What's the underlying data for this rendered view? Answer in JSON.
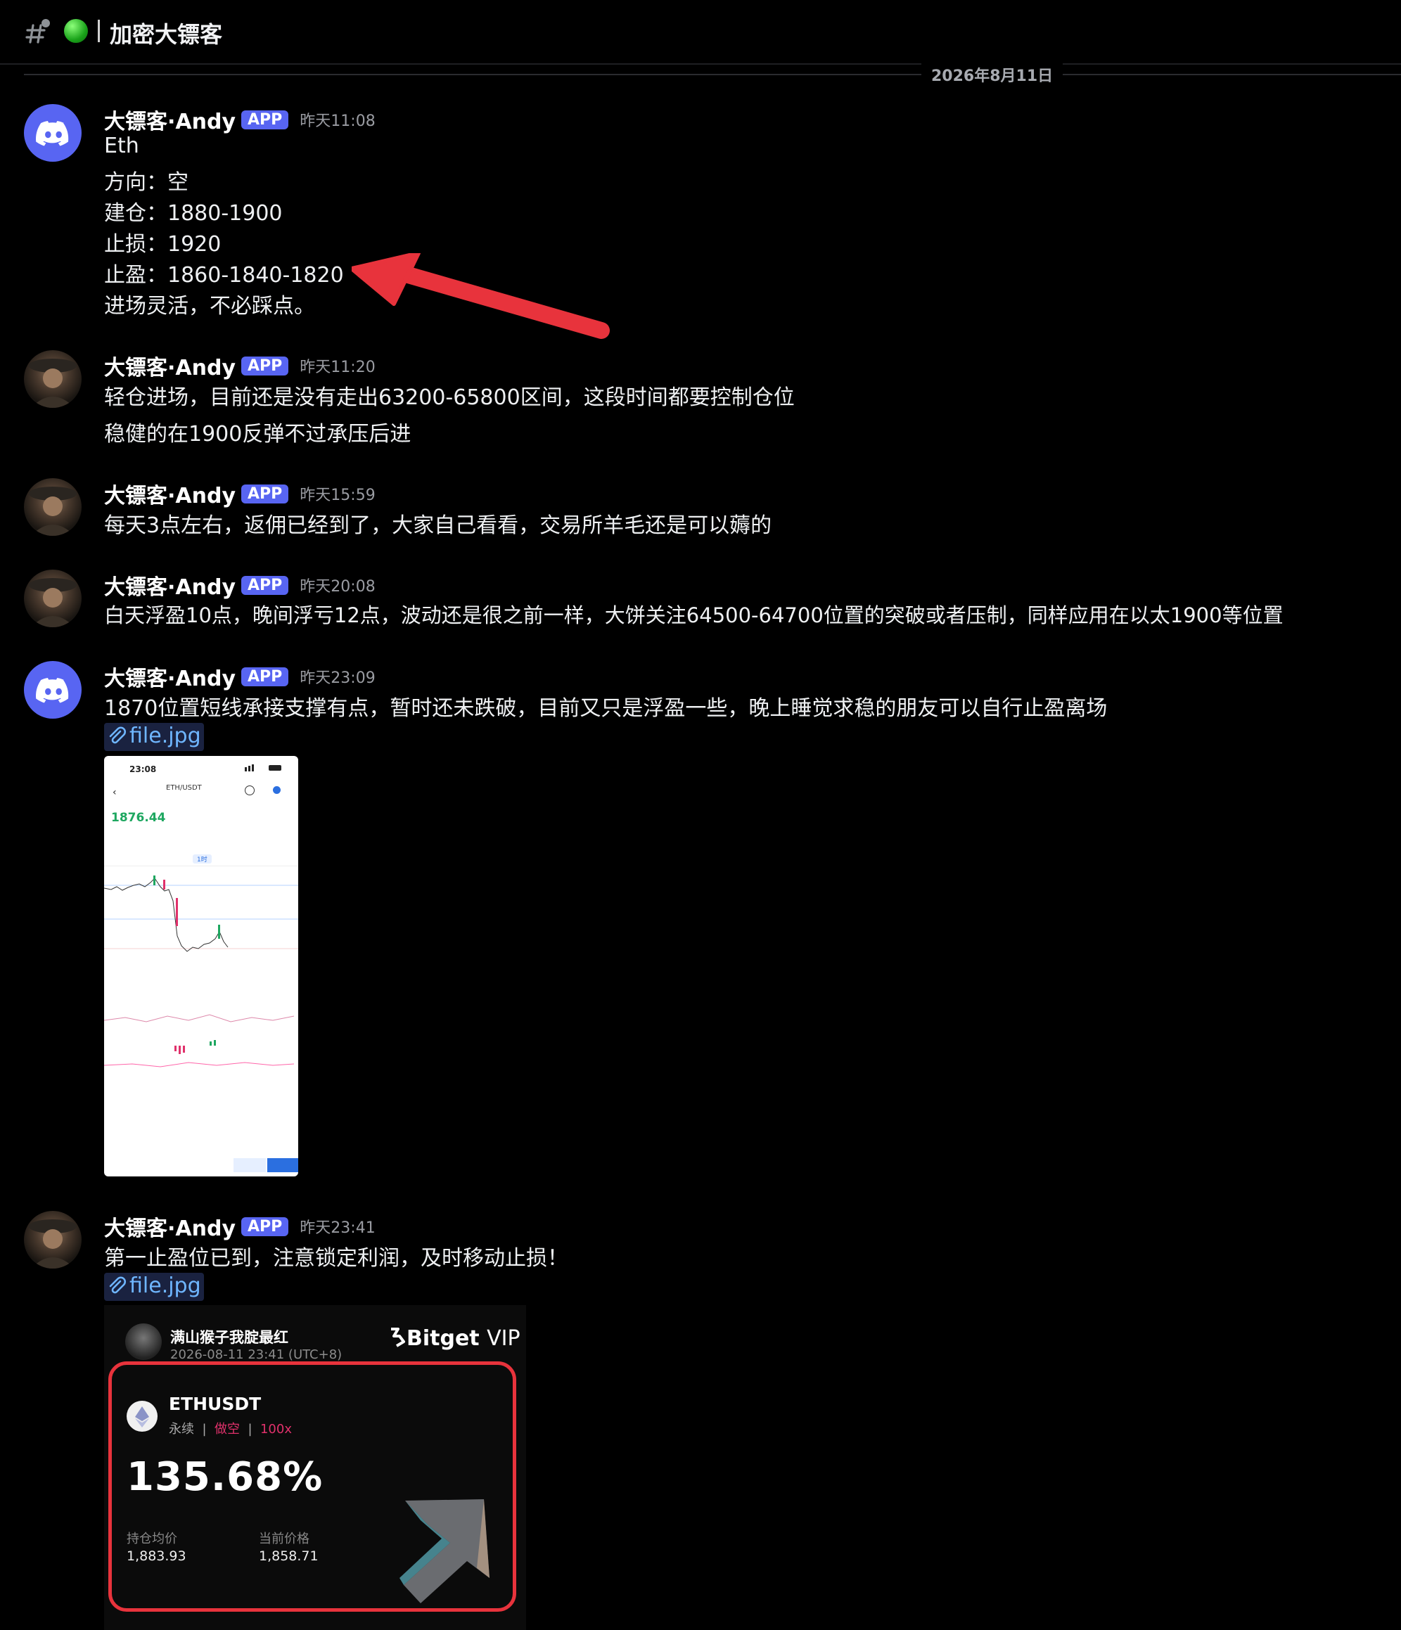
{
  "channel": {
    "name": "加密大镖客",
    "date_divider": "2026年8月11日"
  },
  "messages": [
    {
      "author": "大镖客·Andy",
      "badge": "APP",
      "time": "昨天11:08",
      "avatar": "discord-logo",
      "lines": [
        "Eth",
        "方向：空",
        "建仓：1880-1900",
        "止损：1920",
        "止盈：1860-1840-1820",
        "进场灵活，不必踩点。"
      ]
    },
    {
      "author": "大镖客·Andy",
      "badge": "APP",
      "time": "昨天11:20",
      "avatar": "photo",
      "lines": [
        "轻仓进场，目前还是没有走出63200-65800区间，这段时间都要控制仓位",
        "稳健的在1900反弹不过承压后进"
      ]
    },
    {
      "author": "大镖客·Andy",
      "badge": "APP",
      "time": "昨天15:59",
      "avatar": "photo",
      "lines": [
        "每天3点左右，返佣已经到了，大家自己看看，交易所羊毛还是可以薅的"
      ]
    },
    {
      "author": "大镖客·Andy",
      "badge": "APP",
      "time": "昨天20:08",
      "avatar": "photo",
      "lines": [
        "白天浮盈10点，晚间浮亏12点，波动还是很之前一样，大饼关注64500-64700位置的突破或者压制，同样应用在以太1900等位置"
      ]
    },
    {
      "author": "大镖客·Andy",
      "badge": "APP",
      "time": "昨天23:09",
      "avatar": "discord-logo",
      "lines": [
        "1870位置短线承接支撑有点，暂时还未跌破，目前又只是浮盈一些，晚上睡觉求稳的朋友可以自行止盈离场"
      ],
      "attachment": "file.jpg",
      "phone": {
        "clock": "23:08",
        "pair": "ETH/USDT",
        "price": "1876.44",
        "period": "1时"
      }
    },
    {
      "author": "大镖客·Andy",
      "badge": "APP",
      "time": "昨天23:41",
      "avatar": "photo",
      "lines": [
        "第一止盈位已到，注意锁定利润，及时移动止损！"
      ],
      "attachment": "file.jpg",
      "card": {
        "user": "满山猴子我腚最红",
        "timestamp": "2026-08-11 23:41  (UTC+8)",
        "brand": "Bitget",
        "brand_suffix": "VIP",
        "pair": "ETHUSDT",
        "type": "永续",
        "side": "做空",
        "leverage": "100x",
        "sep": "|",
        "pnl_pct": "135.68%",
        "avg_label": "持仓均价",
        "avg_value": "1,883.93",
        "cur_label": "当前价格",
        "cur_value": "1,858.71"
      }
    }
  ],
  "colors": {
    "background": "#000000",
    "accent": "#5865f2",
    "link": "#6fb6ff",
    "arrow": "#e8333c"
  }
}
